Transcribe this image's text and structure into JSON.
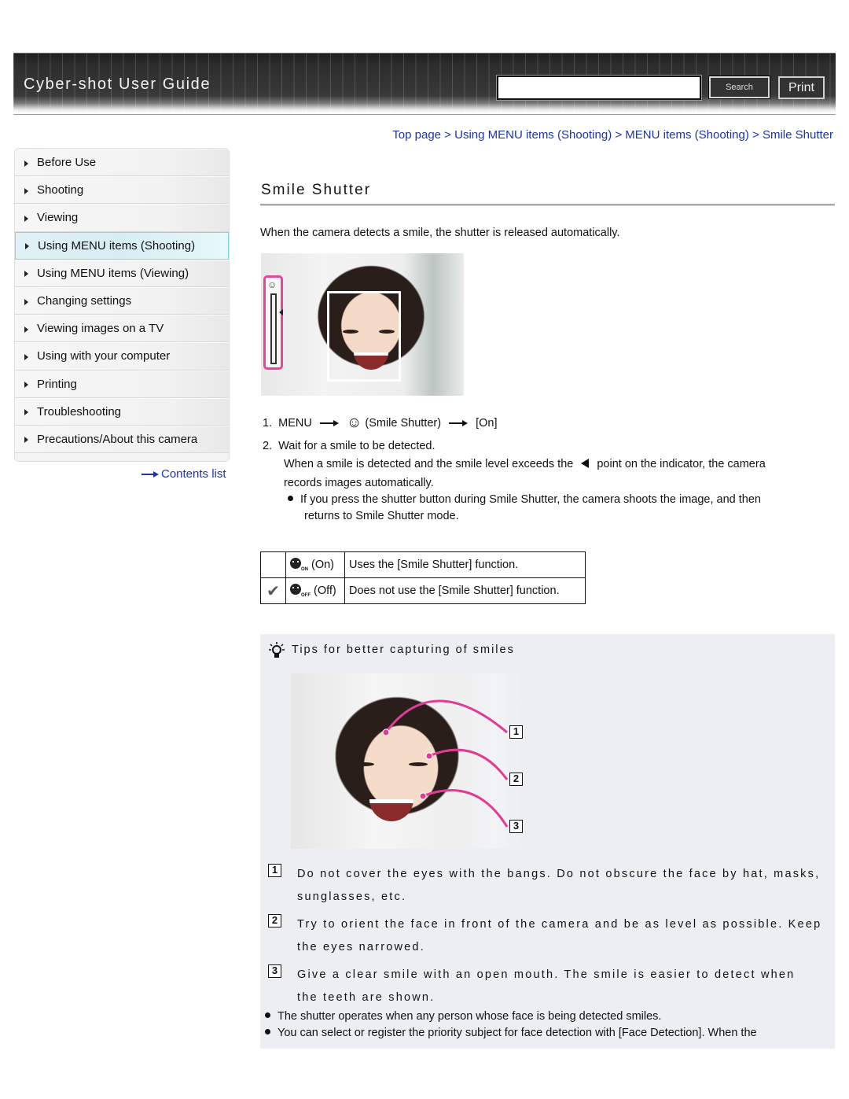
{
  "header": {
    "title": "Cyber-shot User Guide",
    "search_placeholder": "",
    "search_value": "",
    "search_label": "Search",
    "print_label": "Print"
  },
  "sidebar": {
    "items": [
      {
        "label": "Before Use",
        "active": false
      },
      {
        "label": "Shooting",
        "active": false
      },
      {
        "label": "Viewing",
        "active": false
      },
      {
        "label": "Using MENU items (Shooting)",
        "active": true
      },
      {
        "label": "Using MENU items (Viewing)",
        "active": false
      },
      {
        "label": "Changing settings",
        "active": false
      },
      {
        "label": "Viewing images on a TV",
        "active": false
      },
      {
        "label": "Using with your computer",
        "active": false
      },
      {
        "label": "Printing",
        "active": false
      },
      {
        "label": "Troubleshooting",
        "active": false
      },
      {
        "label": "Precautions/About this camera",
        "active": false
      }
    ],
    "contents_link": "Contents list"
  },
  "breadcrumb": {
    "items": [
      "Top page",
      "Using MENU items (Shooting)",
      "MENU items (Shooting)",
      "Smile Shutter"
    ],
    "separator": " > "
  },
  "main": {
    "title": "Smile Shutter",
    "intro": "When the camera detects a smile, the shutter is released automatically.",
    "steps": {
      "s1_num": "1.",
      "s1_menu": "MENU",
      "s1_item": "(Smile Shutter)",
      "s1_value": "[On]",
      "s2_num": "2.",
      "s2_text": "Wait for a smile to be detected.",
      "s2_detail_a": "When a smile is detected and the smile level exceeds the",
      "s2_detail_b": "point on the indicator, the camera",
      "s2_detail_c": "records images automatically.",
      "s2_bullet_a": "If you press the shutter button during Smile Shutter, the camera shoots the image, and then",
      "s2_bullet_b": "returns to Smile Shutter mode."
    },
    "options": [
      {
        "default": false,
        "badge": "ON",
        "label": "(On)",
        "description": "Uses the [Smile Shutter] function."
      },
      {
        "default": true,
        "badge": "OFF",
        "label": "(Off)",
        "description": "Does not use the [Smile Shutter] function."
      }
    ]
  },
  "tips": {
    "title": "Tips for better capturing of smiles",
    "callout_numbers": [
      "1",
      "2",
      "3"
    ],
    "items": [
      {
        "num": "1",
        "line1": "Do not cover the eyes with the bangs. Do not obscure the face by hat, masks,",
        "line2": "sunglasses, etc."
      },
      {
        "num": "2",
        "line1": "Try to orient the face in front of the camera and be as level as possible. Keep",
        "line2": "the eyes narrowed."
      },
      {
        "num": "3",
        "line1": "Give a clear smile with an open mouth. The smile is easier to detect when",
        "line2": "the teeth are shown."
      }
    ],
    "notes": [
      "The shutter operates when any person whose face is being detected smiles.",
      "You can select or register the priority subject for face detection with [Face Detection]. When the"
    ]
  },
  "colors": {
    "link": "#1a33b0",
    "active_nav_border": "#7fd8e6",
    "indicator_pink": "#e9449a",
    "tips_background": "#eceef2"
  }
}
